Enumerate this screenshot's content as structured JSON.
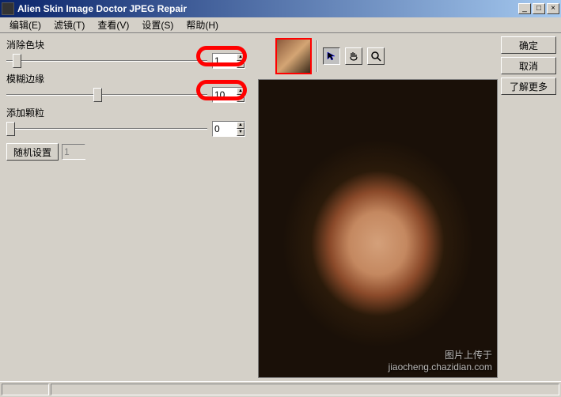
{
  "window": {
    "title": "Alien Skin Image Doctor JPEG Repair"
  },
  "menu": {
    "edit": "编辑(E)",
    "filter": "滤镜(T)",
    "view": "查看(V)",
    "settings": "设置(S)",
    "help": "帮助(H)"
  },
  "sliders": {
    "remove_blocks": {
      "label": "消除色块",
      "value": "1"
    },
    "blur_edges": {
      "label": "模糊边缘",
      "value": "10"
    },
    "add_grain": {
      "label": "添加颗粒",
      "value": "0"
    }
  },
  "buttons": {
    "random": "随机设置",
    "random_val": "1",
    "ok": "确定",
    "cancel": "取消",
    "more": "了解更多"
  },
  "watermark": {
    "line1": "图片上传于",
    "line2": "jiaocheng.chazidian.com"
  },
  "icons": {
    "pointer": "pointer-icon",
    "hand": "hand-icon",
    "zoom": "zoom-icon"
  }
}
